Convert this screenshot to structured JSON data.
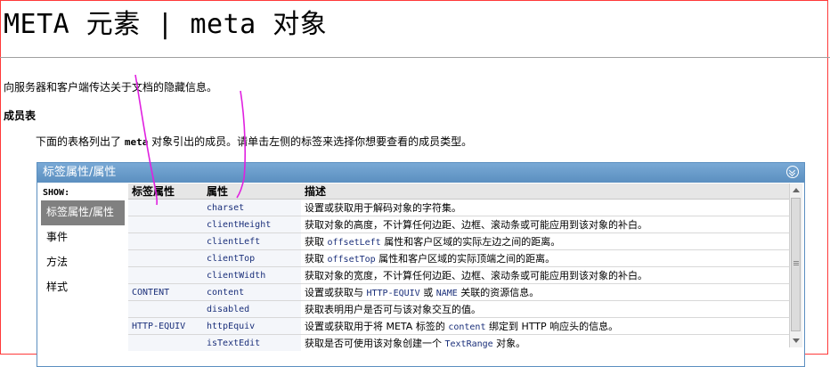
{
  "page": {
    "title": "META 元素 | meta 对象",
    "description": "向服务器和客户端传达关于文档的隐藏信息。",
    "members_heading": "成员表",
    "intro_before": "下面的表格列出了 ",
    "intro_code": "meta",
    "intro_after": " 对象引出的成员。请单击左侧的标签来选择你想要查看的成员类型。"
  },
  "panel": {
    "header": "标签属性/属性",
    "show_label": "SHOW:",
    "sidebar_items": [
      {
        "label": "标签属性/属性",
        "active": true
      },
      {
        "label": "事件",
        "active": false
      },
      {
        "label": "方法",
        "active": false
      },
      {
        "label": "样式",
        "active": false
      }
    ],
    "columns": [
      "标签属性",
      "属性",
      "描述"
    ],
    "rows": [
      {
        "attr": "",
        "prop": "charset",
        "desc": "设置或获取用于解码对象的字符集。"
      },
      {
        "attr": "",
        "prop": "clientHeight",
        "desc": "获取对象的高度，不计算任何边距、边框、滚动条或可能应用到该对象的补白。"
      },
      {
        "attr": "",
        "prop": "clientLeft",
        "desc_parts": [
          "获取 ",
          "offsetLeft",
          " 属性和客户区域的实际左边之间的距离。"
        ]
      },
      {
        "attr": "",
        "prop": "clientTop",
        "desc_parts": [
          "获取 ",
          "offsetTop",
          " 属性和客户区域的实际顶端之间的距离。"
        ]
      },
      {
        "attr": "",
        "prop": "clientWidth",
        "desc": "获取对象的宽度，不计算任何边距、边框、滚动条或可能应用到该对象的补白。"
      },
      {
        "attr": "CONTENT",
        "prop": "content",
        "desc_parts": [
          "设置或获取与 ",
          "HTTP-EQUIV",
          " 或 ",
          "NAME",
          " 关联的资源信息。"
        ]
      },
      {
        "attr": "",
        "prop": "disabled",
        "desc": "获取表明用户是否可与该对象交互的值。"
      },
      {
        "attr": "HTTP-EQUIV",
        "prop": "httpEquiv",
        "desc_parts": [
          "设置或获取用于将 META 标签的 ",
          "content",
          " 绑定到 HTTP 响应头的信息。"
        ]
      },
      {
        "attr": "",
        "prop": "isTextEdit",
        "desc_parts": [
          "获取是否可使用该对象创建一个 ",
          "TextRange",
          " 对象。"
        ]
      }
    ]
  },
  "colors": {
    "header_bg": "#5b8fc0",
    "code_text": "#1a2f7a",
    "annotation_stroke": "#e020e0",
    "frame": "#ff3a3a"
  }
}
